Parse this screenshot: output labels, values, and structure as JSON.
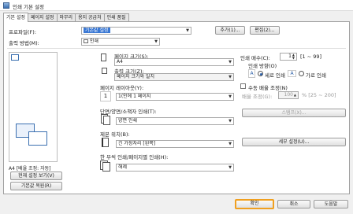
{
  "window": {
    "title": "인쇄 기본 설정"
  },
  "tabs": [
    "기본 설정",
    "페이지 설정",
    "마무리",
    "용지 공급처",
    "인쇄 품질"
  ],
  "profile": {
    "label": "프로파일(F):",
    "value": "기본값 설정",
    "add_label": "추가(1)...",
    "edit_label": "편집(2)..."
  },
  "output": {
    "label": "출력 방법(M):",
    "value": "인쇄"
  },
  "page_size": {
    "label": "페이지 크기(S):",
    "value": "A4"
  },
  "output_size": {
    "label": "출력 크기(Z):",
    "value": "페이지 크기와 일치"
  },
  "layout": {
    "label": "페이지 레이아웃(Y):",
    "value": "1(인에 1 페이지",
    "icon_text": "1"
  },
  "duplex": {
    "label": "단면/양면/소책자 인쇄(T):",
    "value": "양면 인쇄"
  },
  "binding": {
    "label": "제본 위치(B):",
    "value": "긴 가장자리 [왼쪽]"
  },
  "color": {
    "label": "한 부씩 인쇄/페이지별 인쇄(H):",
    "value": "해제"
  },
  "copies": {
    "label": "인쇄 매수(C):",
    "value": "1",
    "range": "[1 ~ 99]"
  },
  "orientation": {
    "label": "인쇄 방향(O)",
    "portrait": "세로 인쇄",
    "landscape": "가로 인쇄",
    "portrait_glyph": "A",
    "landscape_glyph": "A"
  },
  "manual_scaling": {
    "label": "수동 배율 조정(N)",
    "scale_label": "배율 조정(G):",
    "scale_value": "100",
    "scale_range": "% [25 ~ 200]"
  },
  "watermark_button": "스탬프(X)...",
  "advanced_button": "세부 설정(U)...",
  "preview": {
    "caption": "A4 [배율 조정: 자동]",
    "view_settings": "현재 설정 보기(V)",
    "restore_defaults": "기본값 복원(R)"
  },
  "footer": {
    "ok": "확인",
    "cancel": "취소",
    "help": "도움말"
  },
  "colors": {
    "selection": "#3a78d4",
    "focus": "#f0a020"
  }
}
